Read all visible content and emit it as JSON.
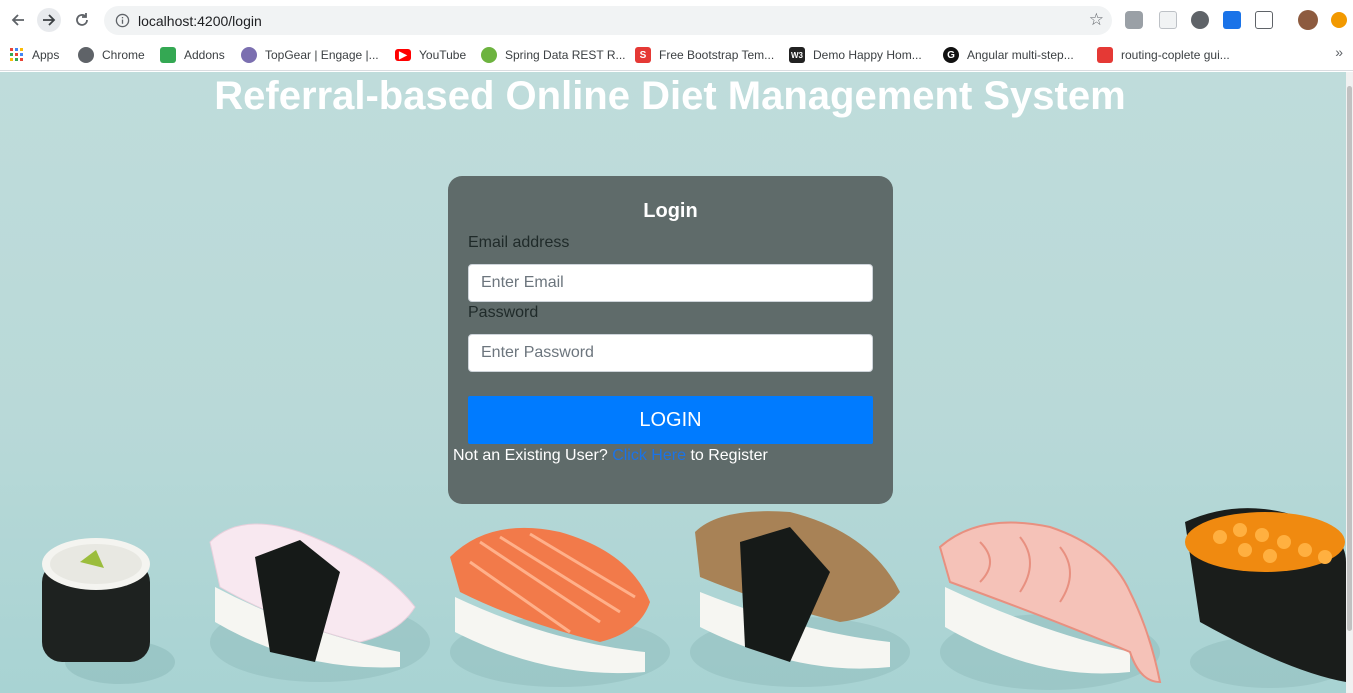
{
  "browser": {
    "url": "localhost:4200/login",
    "bookmarks": [
      {
        "label": "Apps",
        "color": "#ea4335"
      },
      {
        "label": "Chrome",
        "color": "#5f6368"
      },
      {
        "label": "Addons",
        "color": "#34a853"
      },
      {
        "label": "TopGear | Engage |...",
        "color": "#7b6fb0"
      },
      {
        "label": "YouTube",
        "color": "#ff0000"
      },
      {
        "label": "Spring Data REST R...",
        "color": "#6db33f"
      },
      {
        "label": "Free Bootstrap Tem...",
        "color": "#e53935"
      },
      {
        "label": "Demo Happy Hom...",
        "color": "#222222"
      },
      {
        "label": "Angular multi-step...",
        "color": "#111111"
      },
      {
        "label": "routing-coplete gui...",
        "color": "#e53935"
      }
    ]
  },
  "page": {
    "title": "Referral-based Online Diet Management System",
    "accent_color": "#007bff"
  },
  "login": {
    "heading": "Login",
    "email_label": "Email address",
    "email_placeholder": "Enter Email",
    "password_label": "Password",
    "password_placeholder": "Enter Password",
    "button_label": "LOGIN",
    "register_prefix": "Not an Existing User?",
    "register_link": "Click Here",
    "register_suffix": "to Register"
  }
}
